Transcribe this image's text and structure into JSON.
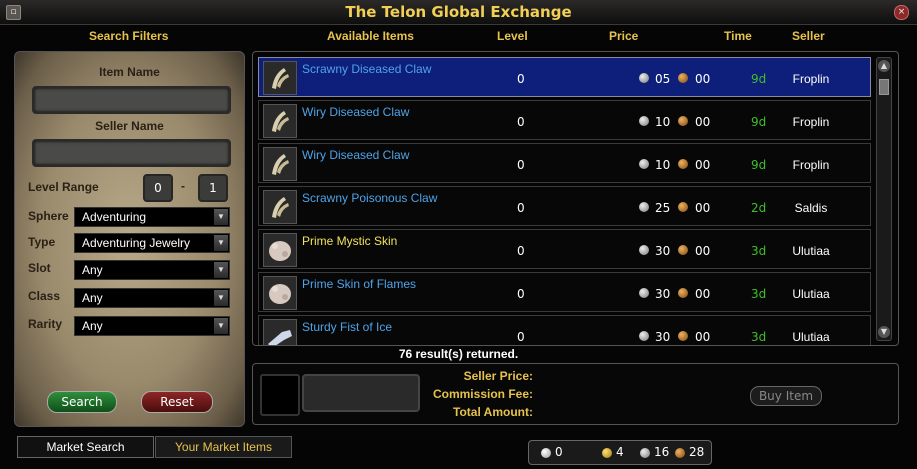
{
  "window": {
    "title": "The Telon Global Exchange"
  },
  "headers": {
    "search_filters": "Search Filters",
    "available_items": "Available Items",
    "level": "Level",
    "price": "Price",
    "time": "Time",
    "seller": "Seller"
  },
  "filters": {
    "item_name_label": "Item Name",
    "item_name_value": "",
    "seller_name_label": "Seller Name",
    "seller_name_value": "",
    "level_range_label": "Level Range",
    "level_min": "0",
    "level_sep": "-",
    "level_max": "1",
    "sphere_label": "Sphere",
    "sphere_value": "Adventuring",
    "type_label": "Type",
    "type_value": "Adventuring Jewelry",
    "slot_label": "Slot",
    "slot_value": "Any",
    "class_label": "Class",
    "class_value": "Any",
    "rarity_label": "Rarity",
    "rarity_value": "Any",
    "search_button": "Search",
    "reset_button": "Reset"
  },
  "items": [
    {
      "name": "Scrawny Diseased Claw",
      "level": "0",
      "silver": "05",
      "copper": "00",
      "time": "9d",
      "seller": "Froplin",
      "icon": "claw-icon",
      "name_color": "#4fa3e8"
    },
    {
      "name": "Wiry Diseased Claw",
      "level": "0",
      "silver": "10",
      "copper": "00",
      "time": "9d",
      "seller": "Froplin",
      "icon": "claw-icon",
      "name_color": "#4fa3e8"
    },
    {
      "name": "Wiry Diseased Claw",
      "level": "0",
      "silver": "10",
      "copper": "00",
      "time": "9d",
      "seller": "Froplin",
      "icon": "claw-icon",
      "name_color": "#4fa3e8"
    },
    {
      "name": "Scrawny Poisonous Claw",
      "level": "0",
      "silver": "25",
      "copper": "00",
      "time": "2d",
      "seller": "Saldis",
      "icon": "claw-icon",
      "name_color": "#4fa3e8"
    },
    {
      "name": "Prime Mystic Skin",
      "level": "0",
      "silver": "30",
      "copper": "00",
      "time": "3d",
      "seller": "Ulutiaa",
      "icon": "skin-icon",
      "name_color": "#f2e15a"
    },
    {
      "name": "Prime Skin of Flames",
      "level": "0",
      "silver": "30",
      "copper": "00",
      "time": "3d",
      "seller": "Ulutiaa",
      "icon": "skin-icon",
      "name_color": "#4fa3e8"
    },
    {
      "name": "Sturdy Fist of Ice",
      "level": "0",
      "silver": "30",
      "copper": "00",
      "time": "3d",
      "seller": "Ulutiaa",
      "icon": "fist-icon",
      "name_color": "#4fa3e8"
    }
  ],
  "selected_index": 0,
  "results_text": "76 result(s) returned.",
  "buy": {
    "seller_price_label": "Seller Price:",
    "commission_fee_label": "Commission Fee:",
    "total_amount_label": "Total Amount:",
    "buy_button": "Buy Item"
  },
  "tabs": {
    "market_search": "Market Search",
    "your_market_items": "Your Market Items"
  },
  "wallet": {
    "platinum": "0",
    "gold": "4",
    "silver": "16",
    "copper": "28"
  },
  "colors": {
    "accent_gold": "#e6c24d",
    "time_green": "#3fbf2a",
    "selected_row": "#0d1f7a"
  }
}
